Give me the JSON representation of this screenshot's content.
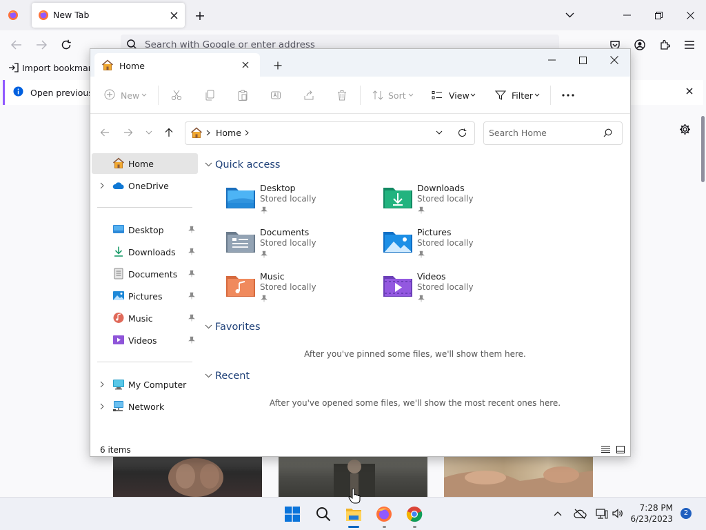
{
  "browser": {
    "tab_title": "New Tab",
    "url_placeholder": "Search with Google or enter address",
    "bookmarks_import_label": "Import bookmarks",
    "notification_text": "Open previous ta"
  },
  "explorer": {
    "tab_title": "Home",
    "commands": {
      "new_label": "New",
      "sort_label": "Sort",
      "view_label": "View",
      "filter_label": "Filter"
    },
    "address": {
      "crumbs": [
        "Home"
      ]
    },
    "search_placeholder": "Search Home",
    "nav": {
      "home": "Home",
      "onedrive": "OneDrive",
      "pinned": [
        {
          "label": "Desktop",
          "icon": "desktop-icon"
        },
        {
          "label": "Downloads",
          "icon": "downloads-icon"
        },
        {
          "label": "Documents",
          "icon": "documents-icon"
        },
        {
          "label": "Pictures",
          "icon": "pictures-icon"
        },
        {
          "label": "Music",
          "icon": "music-icon"
        },
        {
          "label": "Videos",
          "icon": "videos-icon"
        }
      ],
      "my_computer": "My Computer",
      "network": "Network"
    },
    "sections": {
      "quick_access": "Quick access",
      "favorites": "Favorites",
      "recent": "Recent"
    },
    "quick_access_items": [
      {
        "name": "Desktop",
        "status": "Stored locally",
        "icon": "desktop-folder-icon"
      },
      {
        "name": "Downloads",
        "status": "Stored locally",
        "icon": "downloads-folder-icon"
      },
      {
        "name": "Documents",
        "status": "Stored locally",
        "icon": "documents-folder-icon"
      },
      {
        "name": "Pictures",
        "status": "Stored locally",
        "icon": "pictures-folder-icon"
      },
      {
        "name": "Music",
        "status": "Stored locally",
        "icon": "music-folder-icon"
      },
      {
        "name": "Videos",
        "status": "Stored locally",
        "icon": "videos-folder-icon"
      }
    ],
    "favorites_empty": "After you've pinned some files, we'll show them here.",
    "recent_empty": "After you've opened some files, we'll show the most recent ones here.",
    "status_items": "6 items"
  },
  "taskbar": {
    "time": "7:28 PM",
    "date": "6/23/2023",
    "notification_count": "2"
  },
  "colors": {
    "accent": "#0067c0",
    "firefox_purple": "#9059ff",
    "section_header": "#1d3f77"
  }
}
